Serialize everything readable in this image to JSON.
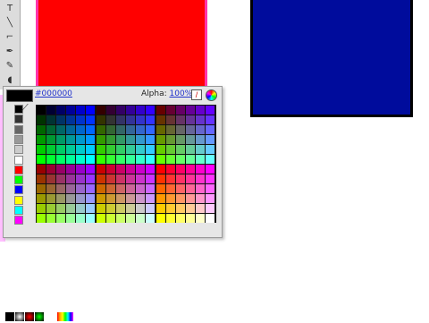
{
  "swatch_panel": {
    "hex_value": "#000000",
    "alpha_label": "Alpha:",
    "alpha_value": "100%",
    "no_color_icon": "slash-icon",
    "wheel_icon": "color-wheel-icon",
    "current_color": "#000000"
  },
  "toolbar": {
    "tools": [
      {
        "name": "text-tool-icon",
        "glyph": "T"
      },
      {
        "name": "line-tool-icon",
        "glyph": "╲"
      },
      {
        "name": "lasso-tool-icon",
        "glyph": "⌐"
      },
      {
        "name": "pen-tool-icon",
        "glyph": "✒"
      },
      {
        "name": "pencil-tool-icon",
        "glyph": "✎"
      },
      {
        "name": "brush-tool-icon",
        "glyph": "◖"
      }
    ]
  },
  "canvas": {
    "red_rect_color": "#ff0000",
    "blue_rect_color": "#000c9c"
  },
  "left_swatches": [
    "#000000",
    "#333333",
    "#666666",
    "#999999",
    "#cccccc",
    "#ffffff",
    "#ff0000",
    "#00ff00",
    "#0000ff",
    "#ffff00",
    "#00ffff",
    "#ff00ff"
  ]
}
